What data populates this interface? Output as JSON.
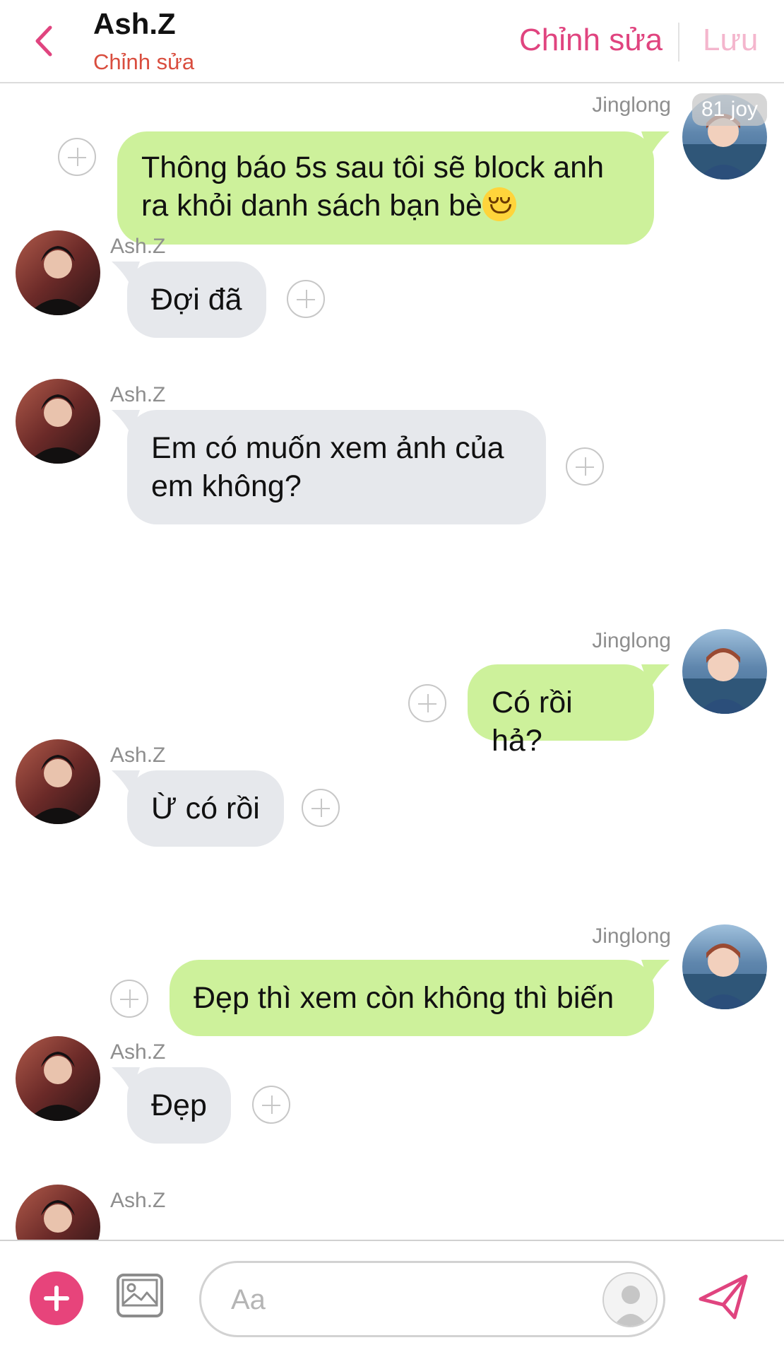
{
  "header": {
    "title": "Ash.Z",
    "subtitle": "Chỉnh sửa",
    "edit_label": "Chỉnh sửa",
    "save_label": "Lưu"
  },
  "overlay_tag": "81 joy",
  "messages": [
    {
      "sender": "Jinglong",
      "line1": "Thông báo 5s sau tôi sẽ block anh",
      "line2": "ra khỏi danh sách bạn bè",
      "emoji": "smiling-face"
    },
    {
      "sender": "Ash.Z",
      "text": "Đợi đã"
    },
    {
      "sender": "Ash.Z",
      "line1": "Em có muốn xem ảnh của",
      "line2": "em không?"
    },
    {
      "sender": "Jinglong",
      "text": "Có rồi hả?"
    },
    {
      "sender": "Ash.Z",
      "text": "Ừ có rồi"
    },
    {
      "sender": "Jinglong",
      "text": "Đẹp thì xem còn không thì biến"
    },
    {
      "sender": "Ash.Z",
      "text": "Đẹp"
    },
    {
      "sender": "Ash.Z",
      "text": ""
    }
  ],
  "composer": {
    "placeholder": "Aa",
    "value": ""
  },
  "colors": {
    "accent": "#e0447f",
    "outgoing_bubble": "#cdf19b",
    "incoming_bubble": "#e6e8ec",
    "subtitle": "#d94d3e",
    "save_disabled": "#f4b6cd"
  },
  "icons": {
    "back": "chevron-left-icon",
    "add": "plus-icon",
    "image": "image-icon",
    "sticker": "avatar-placeholder-icon",
    "send": "paper-plane-icon"
  }
}
